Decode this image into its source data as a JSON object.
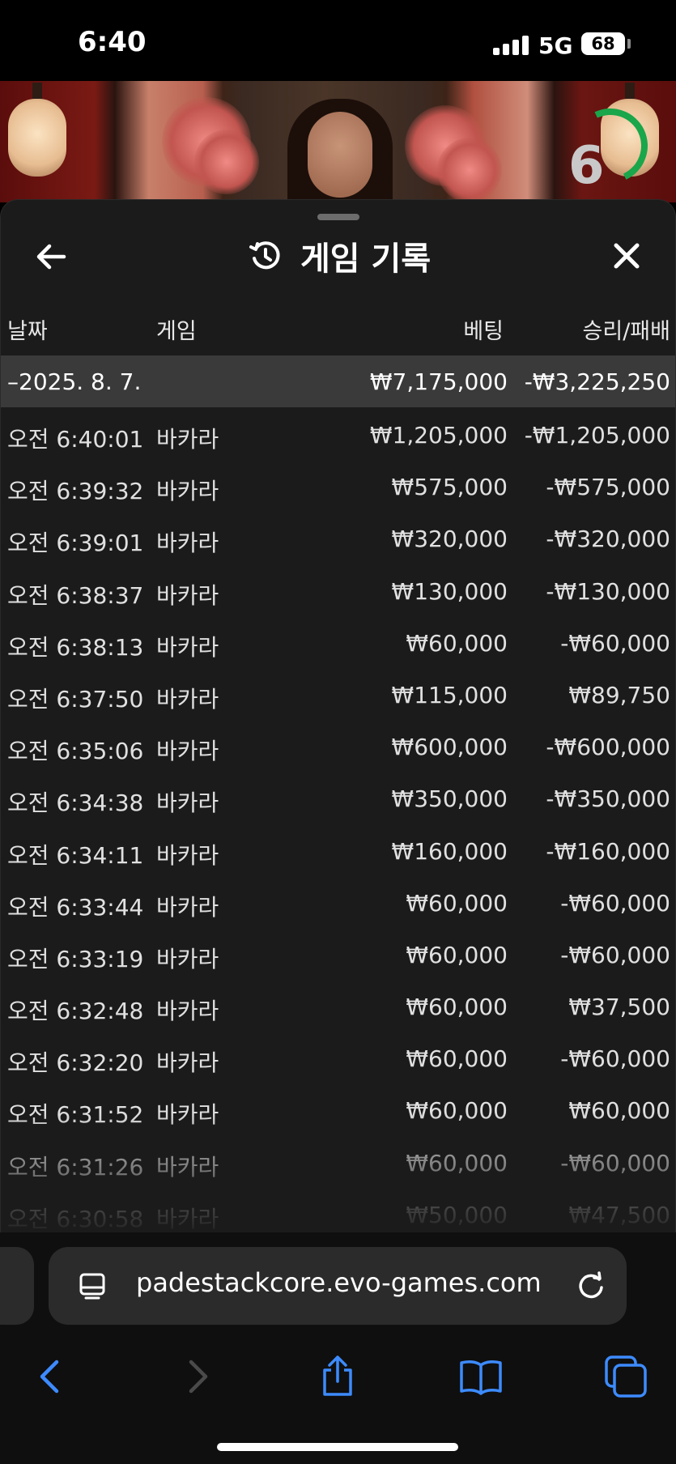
{
  "status_bar": {
    "time": "6:40",
    "network": "5G",
    "battery": "68"
  },
  "video": {
    "timer_value": "6",
    "timer_color": "#1aa64a"
  },
  "panel": {
    "title": "게임 기록",
    "back_icon": "arrow-left-icon",
    "history_icon": "history-icon",
    "close_icon": "close-icon",
    "columns": {
      "date": "날짜",
      "game": "게임",
      "bet": "베팅",
      "result": "승리/패배"
    },
    "group": {
      "date": "–2025. 8. 7.",
      "bet": "₩7,175,000",
      "result": "-₩3,225,250"
    },
    "rows": [
      {
        "time": "오전 6:40:01",
        "game": "바카라",
        "bet": "₩1,205,000",
        "result": "-₩1,205,000"
      },
      {
        "time": "오전 6:39:32",
        "game": "바카라",
        "bet": "₩575,000",
        "result": "-₩575,000"
      },
      {
        "time": "오전 6:39:01",
        "game": "바카라",
        "bet": "₩320,000",
        "result": "-₩320,000"
      },
      {
        "time": "오전 6:38:37",
        "game": "바카라",
        "bet": "₩130,000",
        "result": "-₩130,000"
      },
      {
        "time": "오전 6:38:13",
        "game": "바카라",
        "bet": "₩60,000",
        "result": "-₩60,000"
      },
      {
        "time": "오전 6:37:50",
        "game": "바카라",
        "bet": "₩115,000",
        "result": "₩89,750"
      },
      {
        "time": "오전 6:35:06",
        "game": "바카라",
        "bet": "₩600,000",
        "result": "-₩600,000"
      },
      {
        "time": "오전 6:34:38",
        "game": "바카라",
        "bet": "₩350,000",
        "result": "-₩350,000"
      },
      {
        "time": "오전 6:34:11",
        "game": "바카라",
        "bet": "₩160,000",
        "result": "-₩160,000"
      },
      {
        "time": "오전 6:33:44",
        "game": "바카라",
        "bet": "₩60,000",
        "result": "-₩60,000"
      },
      {
        "time": "오전 6:33:19",
        "game": "바카라",
        "bet": "₩60,000",
        "result": "-₩60,000"
      },
      {
        "time": "오전 6:32:48",
        "game": "바카라",
        "bet": "₩60,000",
        "result": "₩37,500"
      },
      {
        "time": "오전 6:32:20",
        "game": "바카라",
        "bet": "₩60,000",
        "result": "-₩60,000"
      },
      {
        "time": "오전 6:31:52",
        "game": "바카라",
        "bet": "₩60,000",
        "result": "₩60,000"
      },
      {
        "time": "오전 6:31:26",
        "game": "바카라",
        "bet": "₩60,000",
        "result": "-₩60,000"
      },
      {
        "time": "오전 6:30:58",
        "game": "바카라",
        "bet": "₩50,000",
        "result": "₩47,500"
      }
    ]
  },
  "browser": {
    "url": "padestackcore.evo-games.com",
    "reader_icon": "reader-icon",
    "reload_icon": "reload-icon",
    "nav": {
      "back_icon": "chevron-left-icon",
      "forward_icon": "chevron-right-icon",
      "share_icon": "share-icon",
      "bookmarks_icon": "book-icon",
      "tabs_icon": "tabs-icon"
    },
    "accent_color": "#3d8bff"
  }
}
